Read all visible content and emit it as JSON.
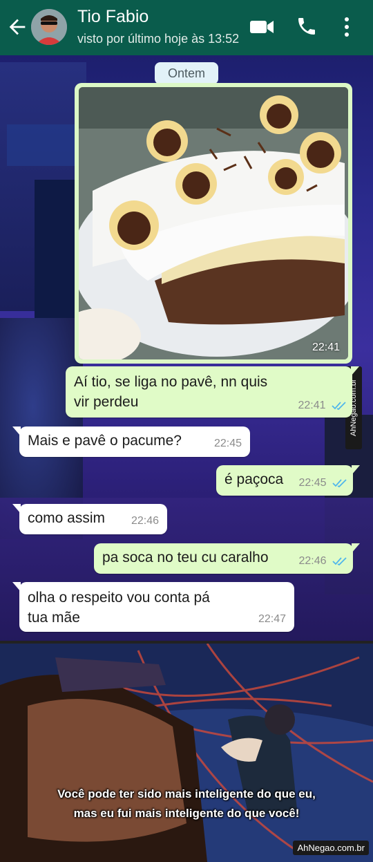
{
  "header": {
    "contact_name": "Tio Fabio",
    "last_seen": "visto por último hoje às 13:52",
    "bg_color": "#0a5c4c"
  },
  "chat": {
    "date_chip": "Ontem",
    "photo_time": "22:41",
    "messages": [
      {
        "dir": "out",
        "lines": [
          "Aí tio, se liga no pavê, nn quis",
          "vir perdeu"
        ],
        "time": "22:41",
        "read": true
      },
      {
        "dir": "in",
        "lines": [
          "Mais e pavê o pacume?"
        ],
        "time": "22:45"
      },
      {
        "dir": "out",
        "lines": [
          "é paçoca"
        ],
        "time": "22:45",
        "read": true
      },
      {
        "dir": "in",
        "lines": [
          "como assim"
        ],
        "time": "22:46"
      },
      {
        "dir": "out",
        "lines": [
          "pa soca no teu cu caralho"
        ],
        "time": "22:46",
        "read": true
      },
      {
        "dir": "in",
        "lines": [
          "olha o respeito vou conta pá",
          "tua mãe"
        ],
        "time": "22:47"
      }
    ]
  },
  "watermark": "AhNegao.com.br",
  "anime_panel": {
    "subtitle_line1": "Você pode ter sido mais inteligente do que eu,",
    "subtitle_line2": "mas eu fui mais inteligente do que você!"
  },
  "icons": [
    "back-arrow-icon",
    "video-call-icon",
    "phone-icon",
    "more-vert-icon",
    "double-check-icon"
  ],
  "colors": {
    "outgoing_bubble": "#e0fbc7",
    "incoming_bubble": "#ffffff",
    "read_ticks": "#4fb6ec"
  }
}
